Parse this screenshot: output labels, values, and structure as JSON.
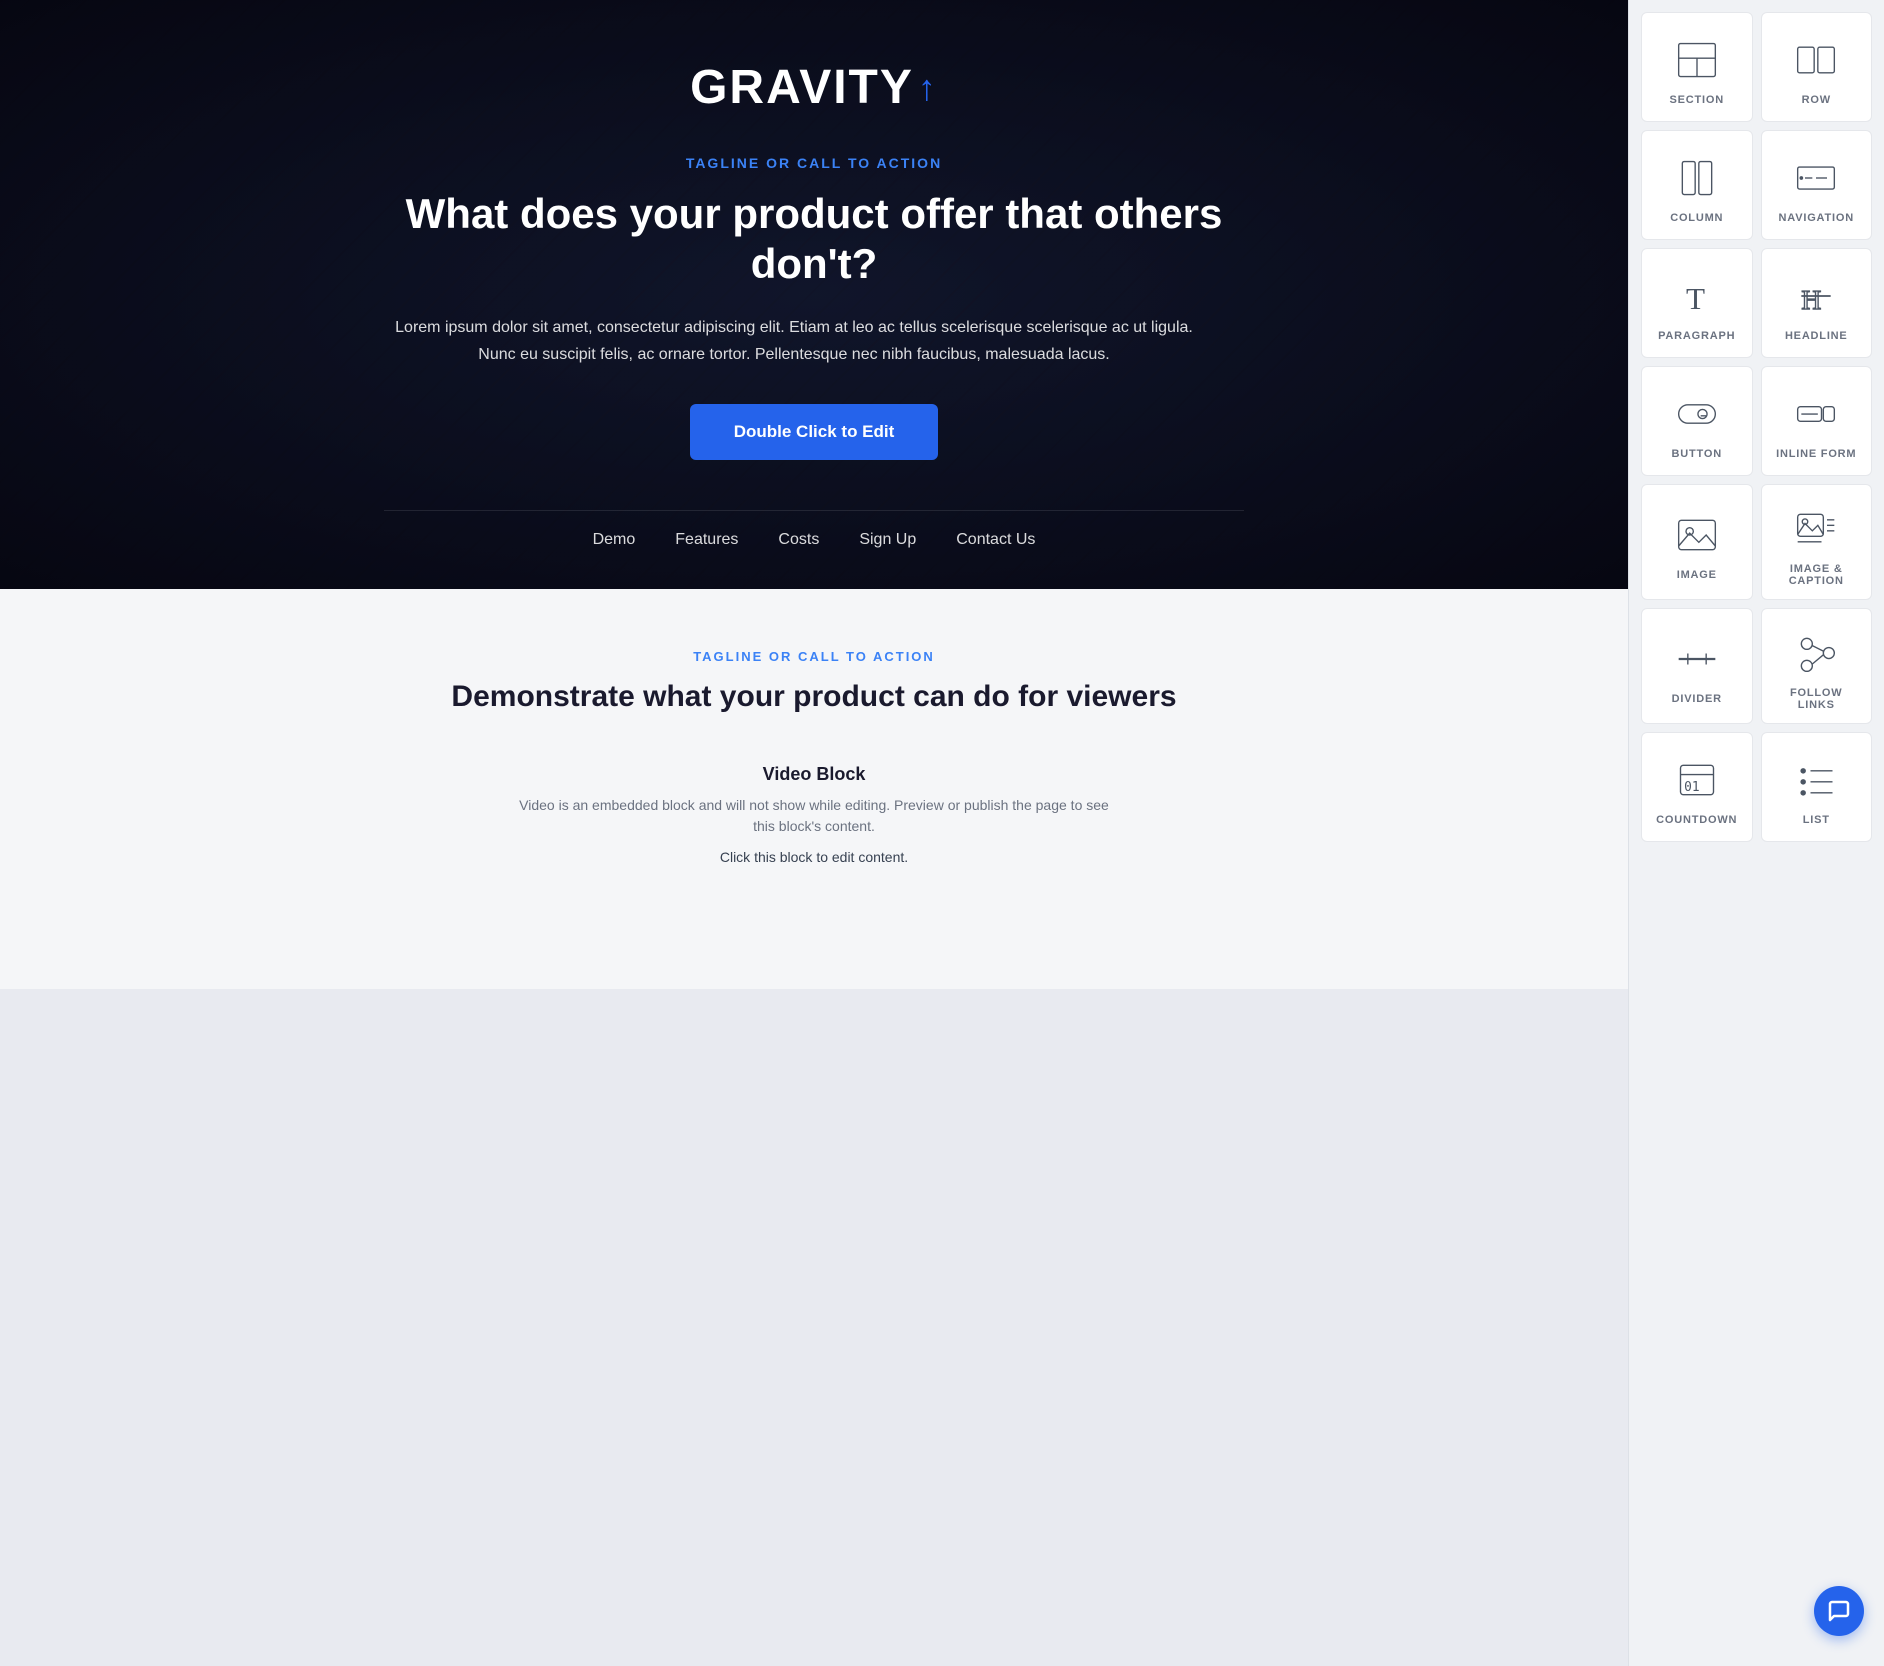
{
  "hero": {
    "brand": "GRAVITY",
    "brand_arrow": "↑",
    "tagline": "TAGLINE OR CALL TO ACTION",
    "headline": "What does your product offer that others don't?",
    "body": "Lorem ipsum dolor sit amet, consectetur adipiscing elit. Etiam at leo ac tellus scelerisque scelerisque ac ut ligula.\nNunc eu suscipit felis, ac ornare tortor. Pellentesque nec nibh faucibus, malesuada lacus.",
    "cta_label": "Double Click to Edit",
    "nav": [
      "Demo",
      "Features",
      "Costs",
      "Sign Up",
      "Contact Us"
    ]
  },
  "content": {
    "tagline": "TAGLINE OR CALL TO ACTION",
    "headline": "Demonstrate what your product can do for viewers",
    "video_title": "Video Block",
    "video_desc": "Video is an embedded block and will not show while editing. Preview or publish the page to see this block's content.",
    "video_edit": "Click this block to edit content."
  },
  "sidebar": {
    "widgets": [
      {
        "id": "section",
        "label": "SECTION"
      },
      {
        "id": "row",
        "label": "ROW"
      },
      {
        "id": "column",
        "label": "COLUMN"
      },
      {
        "id": "navigation",
        "label": "NAVIGATION"
      },
      {
        "id": "paragraph",
        "label": "PARAGRAPH"
      },
      {
        "id": "headline",
        "label": "HEADLINE"
      },
      {
        "id": "button",
        "label": "BUTTON"
      },
      {
        "id": "inline-form",
        "label": "INLINE FORM"
      },
      {
        "id": "image",
        "label": "IMAGE"
      },
      {
        "id": "image-caption",
        "label": "IMAGE & CAPTION"
      },
      {
        "id": "divider",
        "label": "DIVIDER"
      },
      {
        "id": "follow-links",
        "label": "FOLLOW LINKS"
      },
      {
        "id": "countdown",
        "label": "COUNTDOWN"
      },
      {
        "id": "list",
        "label": "LIST"
      }
    ]
  }
}
